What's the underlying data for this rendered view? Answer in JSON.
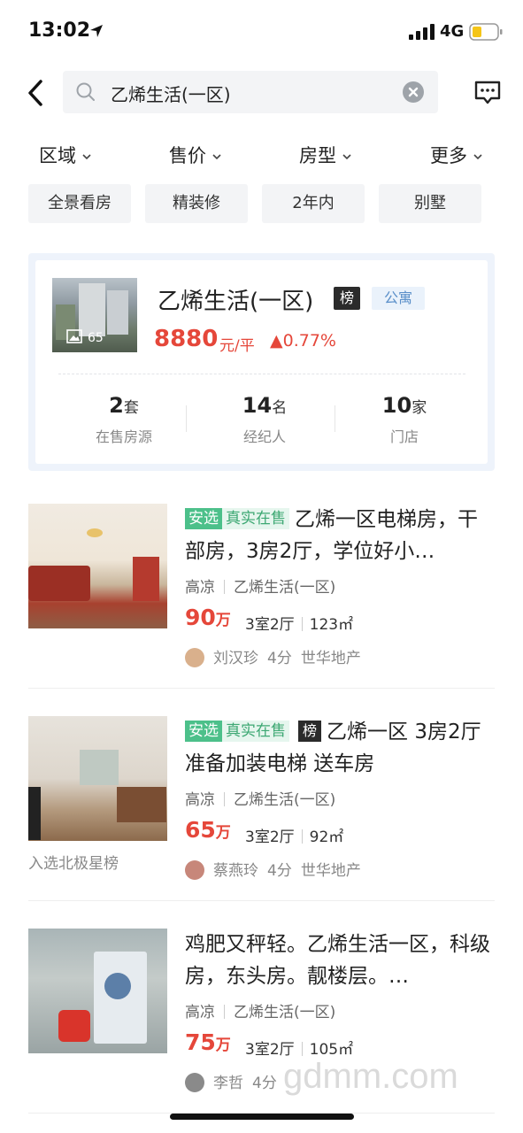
{
  "status_bar": {
    "time": "13:02",
    "network": "4G"
  },
  "search": {
    "query": "乙烯生活(一区)"
  },
  "filters": [
    "区域",
    "售价",
    "房型",
    "更多"
  ],
  "quick_tags": [
    "全景看房",
    "精装修",
    "2年内",
    "别墅"
  ],
  "community": {
    "name": "乙烯生活(一区)",
    "rank_badge": "榜",
    "type_badge": "公寓",
    "photo_count": "65",
    "price": "8880",
    "price_unit": "元/平",
    "change": "▲0.77%",
    "stats": [
      {
        "num": "2",
        "unit": "套",
        "label": "在售房源"
      },
      {
        "num": "14",
        "unit": "名",
        "label": "经纪人"
      },
      {
        "num": "10",
        "unit": "家",
        "label": "门店"
      }
    ]
  },
  "listings": [
    {
      "tag1": "安选",
      "tag2": "真实在售",
      "rank": "",
      "title": "乙烯一区电梯房，干部房，3房2厅，学位好小…",
      "area": "高凉",
      "community": "乙烯生活(一区)",
      "price": "90",
      "price_unit": "万",
      "layout": "3室2厅",
      "size": "123㎡",
      "agent": "刘汉珍",
      "score": "4分",
      "agency": "世华地产",
      "rank_text": ""
    },
    {
      "tag1": "安选",
      "tag2": "真实在售",
      "rank": "榜",
      "title": "乙烯一区 3房2厅 准备加装电梯  送车房",
      "area": "高凉",
      "community": "乙烯生活(一区)",
      "price": "65",
      "price_unit": "万",
      "layout": "3室2厅",
      "size": "92㎡",
      "agent": "蔡燕玲",
      "score": "4分",
      "agency": "世华地产",
      "rank_text": "入选北极星榜"
    },
    {
      "tag1": "",
      "tag2": "",
      "rank": "",
      "title": "鸡肥又秤轻。乙烯生活一区，科级房，东头房。靓楼层。…",
      "area": "高凉",
      "community": "乙烯生活(一区)",
      "price": "75",
      "price_unit": "万",
      "layout": "3室2厅",
      "size": "105㎡",
      "agent": "李哲",
      "score": "4分",
      "agency": "",
      "rank_text": ""
    }
  ],
  "watermark": "gdmm.com"
}
